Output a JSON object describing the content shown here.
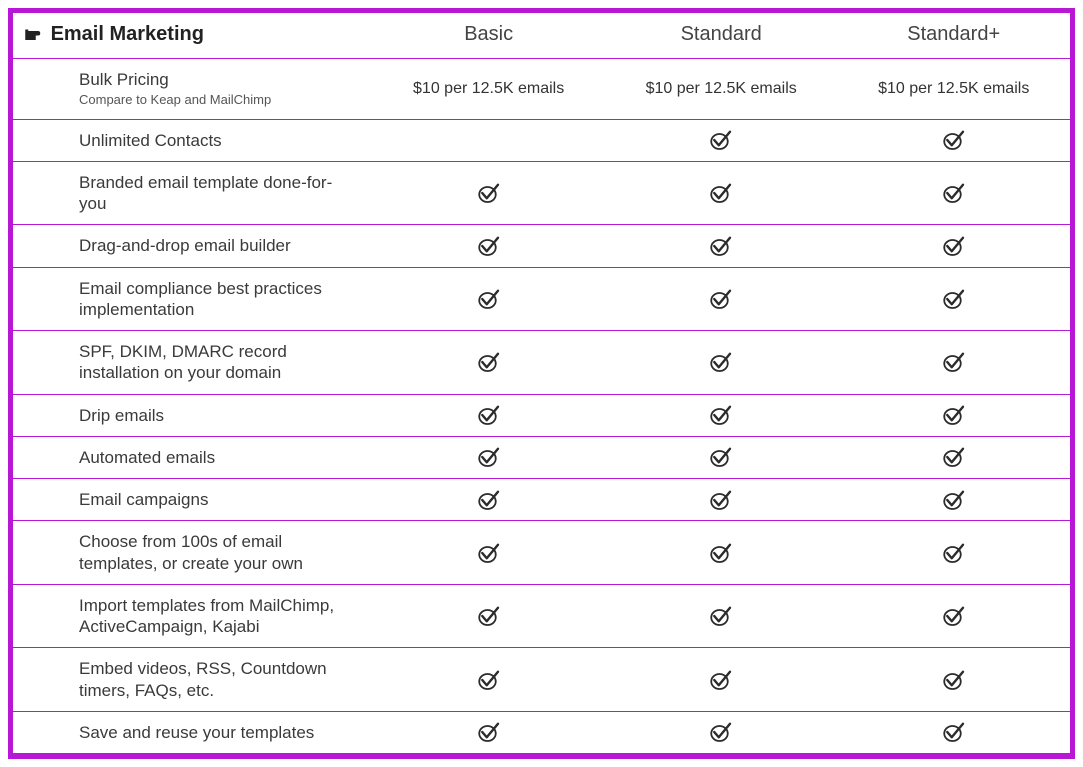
{
  "section_title": "Email Marketing",
  "plans": [
    "Basic",
    "Standard",
    "Standard+"
  ],
  "rows": [
    {
      "label": "Bulk Pricing",
      "sublabel": "Compare to Keap and MailChimp",
      "values": [
        "$10 per 12.5K emails",
        "$10 per 12.5K emails",
        "$10 per 12.5K emails"
      ]
    },
    {
      "label": "Unlimited Contacts",
      "values": [
        false,
        true,
        true
      ]
    },
    {
      "label": "Branded email template done-for-you",
      "values": [
        true,
        true,
        true
      ]
    },
    {
      "label": "Drag-and-drop email builder",
      "values": [
        true,
        true,
        true
      ]
    },
    {
      "label": "Email compliance best practices implementation",
      "values": [
        true,
        true,
        true
      ]
    },
    {
      "label": "SPF, DKIM, DMARC record installation on your domain",
      "values": [
        true,
        true,
        true
      ]
    },
    {
      "label": "Drip emails",
      "values": [
        true,
        true,
        true
      ]
    },
    {
      "label": "Automated emails",
      "values": [
        true,
        true,
        true
      ]
    },
    {
      "label": "Email campaigns",
      "values": [
        true,
        true,
        true
      ]
    },
    {
      "label": "Choose from 100s of email templates, or create your own",
      "values": [
        true,
        true,
        true
      ]
    },
    {
      "label": "Import templates from MailChimp, ActiveCampaign, Kajabi",
      "values": [
        true,
        true,
        true
      ]
    },
    {
      "label": "Embed videos, RSS, Countdown timers, FAQs, etc.",
      "values": [
        true,
        true,
        true
      ]
    },
    {
      "label": "Save and reuse your templates",
      "values": [
        true,
        true,
        true
      ]
    }
  ],
  "chart_data": {
    "type": "table",
    "title": "Email Marketing",
    "columns": [
      "Feature",
      "Basic",
      "Standard",
      "Standard+"
    ],
    "rows": [
      [
        "Bulk Pricing (Compare to Keap and MailChimp)",
        "$10 per 12.5K emails",
        "$10 per 12.5K emails",
        "$10 per 12.5K emails"
      ],
      [
        "Unlimited Contacts",
        "",
        "✓",
        "✓"
      ],
      [
        "Branded email template done-for-you",
        "✓",
        "✓",
        "✓"
      ],
      [
        "Drag-and-drop email builder",
        "✓",
        "✓",
        "✓"
      ],
      [
        "Email compliance best practices implementation",
        "✓",
        "✓",
        "✓"
      ],
      [
        "SPF, DKIM, DMARC record installation on your domain",
        "✓",
        "✓",
        "✓"
      ],
      [
        "Drip emails",
        "✓",
        "✓",
        "✓"
      ],
      [
        "Automated emails",
        "✓",
        "✓",
        "✓"
      ],
      [
        "Email campaigns",
        "✓",
        "✓",
        "✓"
      ],
      [
        "Choose from 100s of email templates, or create your own",
        "✓",
        "✓",
        "✓"
      ],
      [
        "Import templates from MailChimp, ActiveCampaign, Kajabi",
        "✓",
        "✓",
        "✓"
      ],
      [
        "Embed videos, RSS, Countdown timers, FAQs, etc.",
        "✓",
        "✓",
        "✓"
      ],
      [
        "Save and reuse your templates",
        "✓",
        "✓",
        "✓"
      ]
    ]
  }
}
